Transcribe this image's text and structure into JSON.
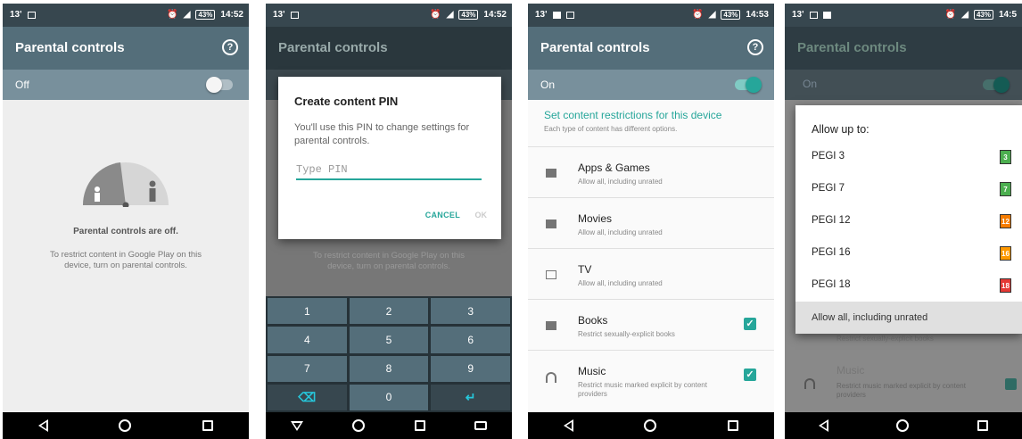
{
  "status": {
    "left": "13'",
    "battery": "43%",
    "times": [
      "14:52",
      "14:52",
      "14:53",
      "14:5"
    ]
  },
  "app": {
    "title": "Parental controls"
  },
  "screen1": {
    "toggle_label": "Off",
    "off_title": "Parental controls are off.",
    "off_desc": "To restrict content in Google Play on this device, turn on parental controls."
  },
  "screen2": {
    "dialog_title": "Create content PIN",
    "dialog_text": "You'll use this PIN to change settings for parental controls.",
    "pin_placeholder": "Type PIN",
    "cancel_label": "CANCEL",
    "ok_label": "OK",
    "bg_text": "To restrict content in Google Play on this device, turn on parental controls.",
    "keys": [
      "1",
      "2",
      "3",
      "4",
      "5",
      "6",
      "7",
      "8",
      "9",
      "⌫",
      "0",
      "↵"
    ]
  },
  "screen3": {
    "toggle_label": "On",
    "heading": "Set content restrictions for this device",
    "subheading": "Each type of content has different options.",
    "categories": [
      {
        "name": "Apps & Games",
        "desc": "Allow all, including unrated",
        "checked": false
      },
      {
        "name": "Movies",
        "desc": "Allow all, including unrated",
        "checked": false
      },
      {
        "name": "TV",
        "desc": "Allow all, including unrated",
        "checked": false
      },
      {
        "name": "Books",
        "desc": "Restrict sexually-explicit books",
        "checked": true
      },
      {
        "name": "Music",
        "desc": "Restrict music marked explicit by content providers",
        "checked": true
      }
    ]
  },
  "screen4": {
    "toggle_label": "On",
    "sheet_title": "Allow up to:",
    "ratings": [
      {
        "name": "PEGI 3",
        "badge": "3",
        "color": "#4caf50"
      },
      {
        "name": "PEGI 7",
        "badge": "7",
        "color": "#4caf50"
      },
      {
        "name": "PEGI 12",
        "badge": "12",
        "color": "#f57c00"
      },
      {
        "name": "PEGI 16",
        "badge": "16",
        "color": "#ff9800"
      },
      {
        "name": "PEGI 18",
        "badge": "18",
        "color": "#e53935"
      }
    ],
    "allow_all": "Allow all, including unrated",
    "bg_books_desc": "Restrict sexually-explicit books",
    "bg_music": "Music",
    "bg_music_desc": "Restrict music marked explicit by content providers"
  },
  "colors": {
    "accent": "#26a69a",
    "appbar": "#546e7a",
    "statusbar": "#37474f"
  }
}
